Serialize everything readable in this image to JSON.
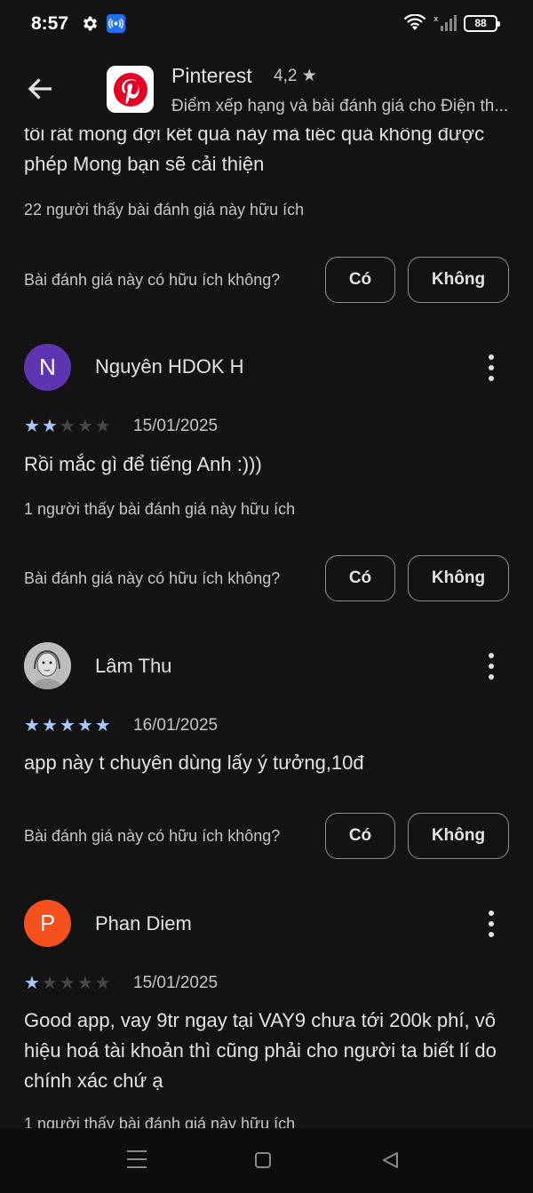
{
  "status_bar": {
    "time": "8:57",
    "battery": "88"
  },
  "app": {
    "name": "Pinterest",
    "rating": "4,2 ★",
    "subtitle": "Điểm xếp hạng và bài đánh giá cho Điện th...",
    "brand_color": "#e60023"
  },
  "prev_review": {
    "text_tail": "tôi rất mong đợi kết quả này mà tiếc quá không được phép Mong bạn sẽ cải thiện",
    "helpful_count": "22 người thấy bài đánh giá này hữu ích",
    "question": "Bài đánh giá này có hữu ích không?",
    "yes_label": "Có",
    "no_label": "Không"
  },
  "reviews": [
    {
      "author": "Nguyên HDOK H",
      "avatar_letter": "N",
      "avatar_color": "#5e35b1",
      "stars": 2,
      "date": "15/01/2025",
      "text": "Rồi mắc gì để tiếng Anh :)))",
      "helpful_count": "1 người thấy bài đánh giá này hữu ích",
      "question": "Bài đánh giá này có hữu ích không?",
      "yes_label": "Có",
      "no_label": "Không"
    },
    {
      "author": "Lâm Thu",
      "avatar_letter": "",
      "avatar_color": "#6d6d6d",
      "stars": 5,
      "date": "16/01/2025",
      "text": "app này t chuyên dùng lấy ý tưởng,10đ",
      "question": "Bài đánh giá này có hữu ích không?",
      "yes_label": "Có",
      "no_label": "Không"
    },
    {
      "author": "Phan Diem",
      "avatar_letter": "P",
      "avatar_color": "#f4511e",
      "stars": 1,
      "date": "15/01/2025",
      "text": "Good app, vay 9tr ngay tại VAY9 chưa tới 200k phí, vô hiệu hoá tài khoản thì cũng phải cho người ta biết lí do chính xác chứ ạ",
      "helpful_count": "1 người thấy bài đánh giá này hữu ích"
    }
  ]
}
